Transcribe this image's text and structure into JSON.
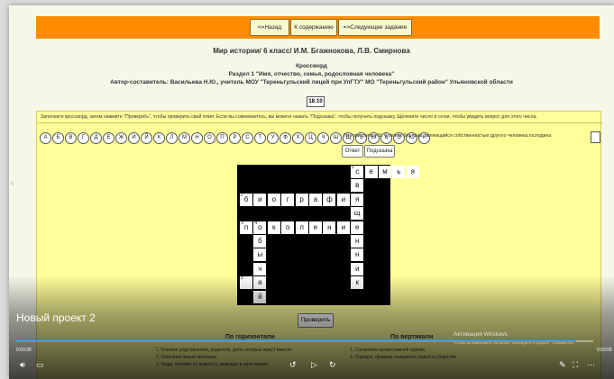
{
  "nav": {
    "back": "<=Назад",
    "contents": "К содержанию",
    "next": "=>Следующее задание"
  },
  "header": {
    "title": "Мир истории/ 6 класс/ И.М. Бгажнокова, Л.В. Смирнова",
    "subtitle": "Кроссворд",
    "section": "Раздел 1 \"Имя, отчество, семья, родословная человека\"",
    "author": "Автор-составитель: Васильева Н.Ю., учитель МОУ \"Тереньгульский лицей при УлГТУ\" МО \"Тереньгульский район\" Ульяновской области"
  },
  "timer": "18:10",
  "instructions": "Заполните кроссворд, затем нажмите \"Проверить\", чтобы проверить свой ответ. Если вы сомневаетесь, вы можете нажать \"Подсказка\", чтобы получить подсказку. Щёлкните число в сетки, чтобы увидеть вопрос для этого числа.",
  "alphabet": [
    "А",
    "Б",
    "В",
    "Г",
    "Д",
    "Е",
    "Ж",
    "И",
    "Й",
    "К",
    "Л",
    "М",
    "Н",
    "О",
    "П",
    "Р",
    "С",
    "Т",
    "У",
    "Ф",
    "Х",
    "Ц",
    "Ч",
    "Ш",
    "Щ",
    "Ъ",
    "Ы",
    "Ь",
    "Э",
    "Ю",
    "Я"
  ],
  "question": "По горизонтали 5: Человек без прав, являющийся собственностью другого человека,господина",
  "buttons": {
    "answer": "Ответ",
    "hint": "Подсказка",
    "check": "Проверить"
  },
  "crossword": [
    {
      "r": 0,
      "c": 8,
      "t": "с",
      "n": "1"
    },
    {
      "r": 0,
      "c": 9,
      "t": "е"
    },
    {
      "r": 0,
      "c": 10,
      "t": "м"
    },
    {
      "r": 0,
      "c": 11,
      "t": "ь"
    },
    {
      "r": 0,
      "c": 12,
      "t": "я"
    },
    {
      "r": 1,
      "c": 8,
      "t": "в"
    },
    {
      "r": 2,
      "c": 0,
      "t": "б",
      "n": "2"
    },
    {
      "r": 2,
      "c": 1,
      "t": "и"
    },
    {
      "r": 2,
      "c": 2,
      "t": "о"
    },
    {
      "r": 2,
      "c": 3,
      "t": "г"
    },
    {
      "r": 2,
      "c": 4,
      "t": "р"
    },
    {
      "r": 2,
      "c": 5,
      "t": "а"
    },
    {
      "r": 2,
      "c": 6,
      "t": "ф"
    },
    {
      "r": 2,
      "c": 7,
      "t": "и"
    },
    {
      "r": 2,
      "c": 8,
      "t": "я"
    },
    {
      "r": 3,
      "c": 8,
      "t": "щ"
    },
    {
      "r": 4,
      "c": 0,
      "t": "п",
      "n": "3"
    },
    {
      "r": 4,
      "c": 1,
      "t": "о",
      "n": "4"
    },
    {
      "r": 4,
      "c": 2,
      "t": "к"
    },
    {
      "r": 4,
      "c": 3,
      "t": "о"
    },
    {
      "r": 4,
      "c": 4,
      "t": "л"
    },
    {
      "r": 4,
      "c": 5,
      "t": "е"
    },
    {
      "r": 4,
      "c": 6,
      "t": "н"
    },
    {
      "r": 4,
      "c": 7,
      "t": "и"
    },
    {
      "r": 4,
      "c": 8,
      "t": "е"
    },
    {
      "r": 5,
      "c": 1,
      "t": "б"
    },
    {
      "r": 5,
      "c": 8,
      "t": "н"
    },
    {
      "r": 6,
      "c": 1,
      "t": "ы"
    },
    {
      "r": 6,
      "c": 8,
      "t": "н"
    },
    {
      "r": 7,
      "c": 1,
      "t": "ч"
    },
    {
      "r": 7,
      "c": 8,
      "t": "и"
    },
    {
      "r": 8,
      "c": 0,
      "t": "",
      "n": "5"
    },
    {
      "r": 8,
      "c": 1,
      "t": "а"
    },
    {
      "r": 8,
      "c": 8,
      "t": "к"
    },
    {
      "r": 9,
      "c": 1,
      "t": "й"
    }
  ],
  "across_title": "По горизонтали",
  "down_title": "По вертикали",
  "across_clues": [
    "1. Близкие родственники, родители, дети, которые живут вместе.",
    "2. Описание жизни человека.",
    "3. Люди, близкие по возрасту, живущие в одно время."
  ],
  "down_clues": [
    "1. Служитель православной церкви.",
    "4. Порядок, правила поведения людей в обществе."
  ],
  "player": {
    "project_title": "Новый проект 2",
    "time_left": "0:03:39",
    "time_right": "0:03:55",
    "progress": 0.97
  },
  "watermark": {
    "title": "Активация Windows",
    "text": "Чтобы активировать Windows, перейдите в раздел \"Параметры\"."
  }
}
